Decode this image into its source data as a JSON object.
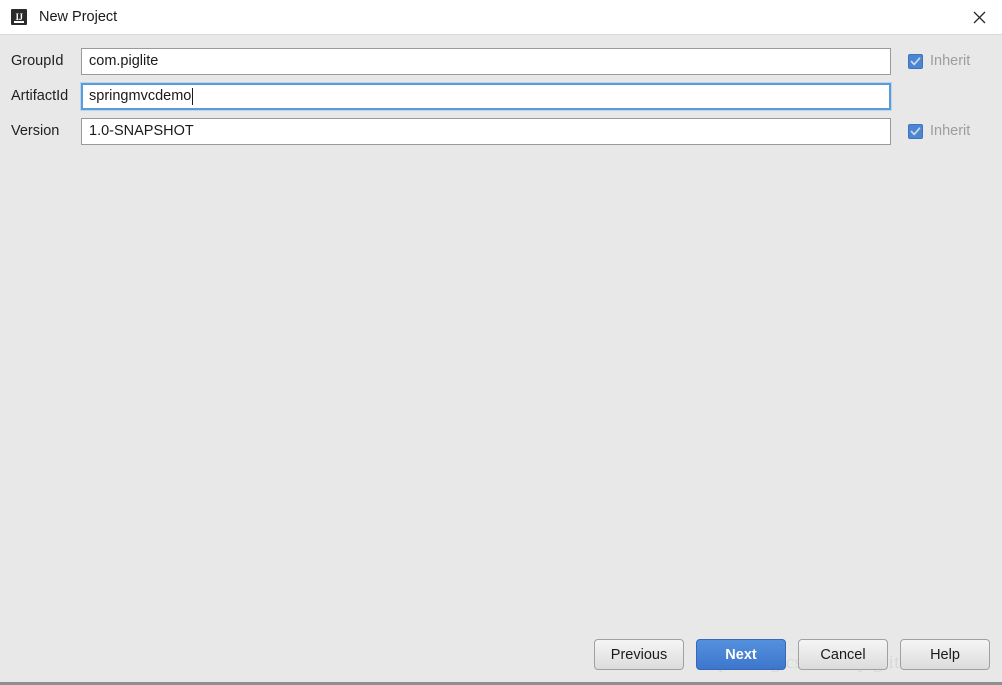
{
  "window": {
    "title": "New Project",
    "app_icon": "intellij-idea-icon",
    "icon_text": "IJ",
    "close_icon": "close-icon"
  },
  "form": {
    "fields": [
      {
        "label": "GroupId",
        "value": "com.piglite",
        "focused": false,
        "inherit": {
          "label": "Inherit",
          "checked": true,
          "enabled": false
        }
      },
      {
        "label": "ArtifactId",
        "value": "springmvcdemo",
        "focused": true,
        "inherit": null
      },
      {
        "label": "Version",
        "value": "1.0-SNAPSHOT",
        "focused": false,
        "inherit": {
          "label": "Inherit",
          "checked": true,
          "enabled": false
        }
      }
    ]
  },
  "watermark": {
    "text": "http://blog.csdn.net/piglite"
  },
  "buttons": {
    "previous": "Previous",
    "next": "Next",
    "cancel": "Cancel",
    "help": "Help"
  },
  "colors": {
    "accent": "#4a80d0",
    "checkbox": "#4a86d4",
    "focus_border": "#5b9bd8",
    "background": "#e8e8e8",
    "titlebar": "#ffffff",
    "disabled_text": "#9d9d9d"
  }
}
